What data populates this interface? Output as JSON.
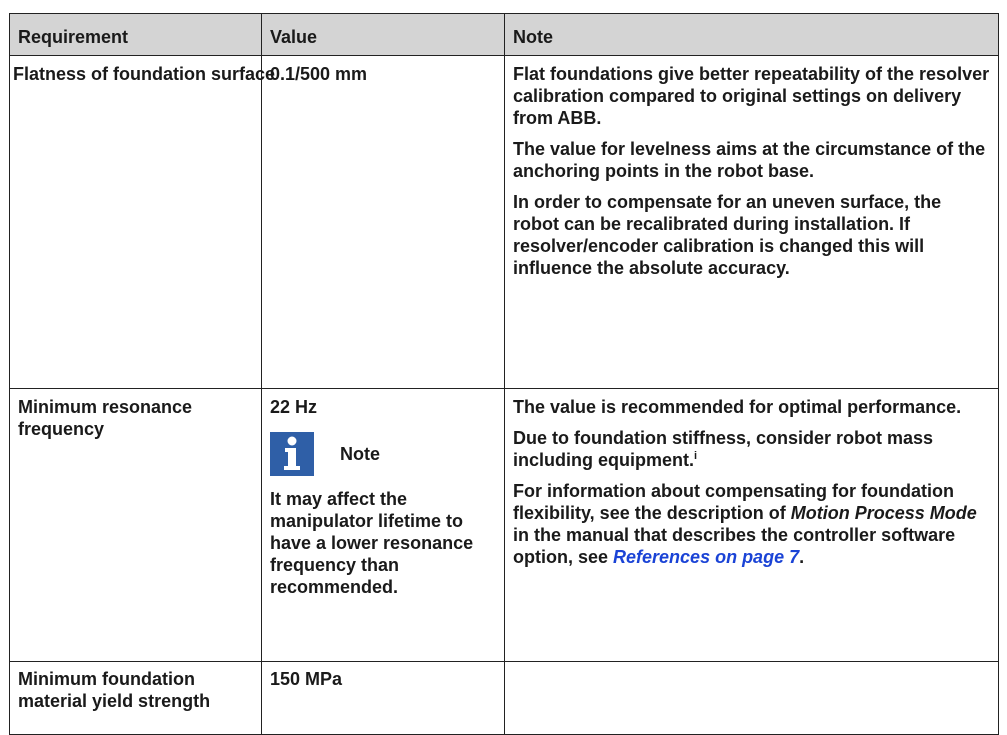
{
  "table": {
    "headers": [
      "Requirement",
      "Value",
      "Note"
    ],
    "rows": [
      {
        "requirement": "Flatness of foundation surface",
        "value": "0.1/500 mm",
        "notes": [
          "Flat foundations give better repeatability of the resolver calibration compared to original settings on delivery from ABB.",
          "The value for levelness aims at the circumstance of the anchoring points in the robot base.",
          "In order to compensate for an uneven surface, the robot can be recalibrated during installation. If resolver/encoder calibration is changed this will influence the absolute accuracy."
        ]
      },
      {
        "requirement": "Minimum resonance frequency",
        "value": "22 Hz",
        "value_note": {
          "icon": "info-icon",
          "title": "Note",
          "text": "It may affect the manipulator lifetime to have a lower resonance frequency than recommended."
        },
        "notes": [
          "The value is recommended for optimal performance.",
          "Due to foundation stiffness, consider robot mass including equipment."
        ],
        "footnote_mark": "i",
        "info_prefix": "For information about compensating for foundation flexibility, see the description of ",
        "info_term": "Motion Process Mode",
        "info_middle": " in the manual that describes the controller software option, see ",
        "info_link": "References on page 7",
        "info_suffix": "."
      },
      {
        "requirement": "Minimum foundation material yield strength",
        "value": "150 MPa",
        "notes": []
      }
    ]
  }
}
